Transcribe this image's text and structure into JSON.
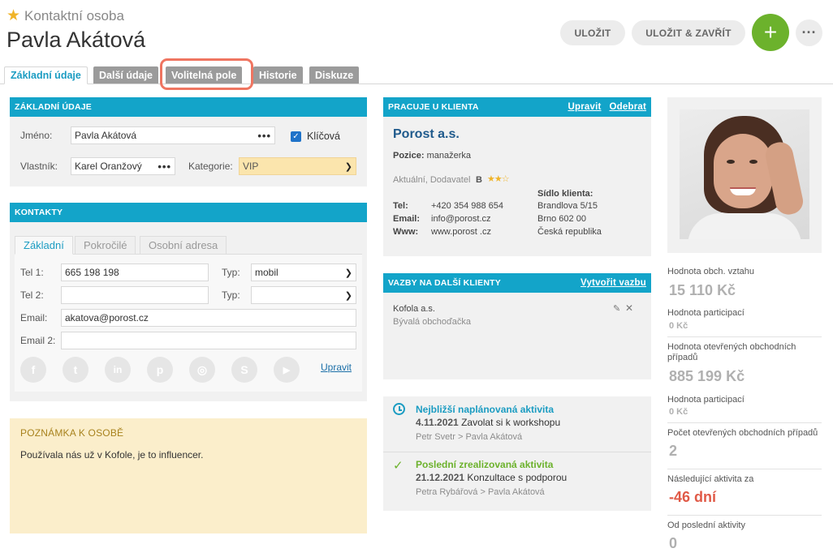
{
  "header": {
    "subtitle": "Kontaktní osoba",
    "title": "Pavla Akátová",
    "save_label": "ULOŽIT",
    "save_close_label": "ULOŽIT & ZAVŘÍT",
    "add_label": "+",
    "more_label": "···"
  },
  "tabs": [
    {
      "label": "Základní údaje"
    },
    {
      "label": "Další údaje"
    },
    {
      "label": "Volitelná pole"
    },
    {
      "label": "Historie"
    },
    {
      "label": "Diskuze"
    }
  ],
  "basic": {
    "heading": "ZÁKLADNÍ ÚDAJE",
    "name_label": "Jméno:",
    "name_value": "Pavla Akátová",
    "key_label": "Klíčová",
    "owner_label": "Vlastník:",
    "owner_value": "Karel Oranžový",
    "category_label": "Kategorie:",
    "category_value": "VIP",
    "dots": "•••"
  },
  "contacts": {
    "heading": "KONTAKTY",
    "subtabs": [
      "Základní",
      "Pokročilé",
      "Osobní adresa"
    ],
    "tel1_label": "Tel 1:",
    "tel1_value": "665 198 198",
    "type_label": "Typ:",
    "type1_value": "mobil",
    "tel2_label": "Tel 2:",
    "type2_label": "Typ:",
    "email_label": "Email:",
    "email_value": "akatova@porost.cz",
    "email2_label": "Email 2:",
    "edit_link": "Upravit",
    "social_icons": [
      "facebook-icon",
      "twitter-icon",
      "linkedin-icon",
      "pinterest-icon",
      "instagram-icon",
      "skype-icon",
      "youtube-icon"
    ]
  },
  "note": {
    "heading": "POZNÁMKA K OSOBĚ",
    "text": "Používala nás už v Kofole, je to influencer."
  },
  "client": {
    "heading": "PRACUJE U KLIENTA",
    "edit_link": "Upravit",
    "remove_link": "Odebrat",
    "name": "Porost a.s.",
    "position_label": "Pozice:",
    "position_value": "manažerka",
    "status": "Aktuální, Dodavatel",
    "rating_letter": "B",
    "tel_label": "Tel:",
    "tel_value": "+420 354 988 654",
    "email_label": "Email:",
    "email_value": "info@porost.cz",
    "www_label": "Www:",
    "www_value": "www.porost .cz",
    "seat_label": "Sídlo klienta:",
    "address1": "Brandlova 5/15",
    "address2": "Brno 602 00",
    "address3": "Česká republika"
  },
  "relations": {
    "heading": "VAZBY NA DALŠÍ KLIENTY",
    "create_link": "Vytvořit vazbu",
    "item_name": "Kofola a.s.",
    "item_role": "Bývalá obchoďačka"
  },
  "activities": {
    "next_title": "Nejbližší naplánovaná aktivita",
    "next_date": "4.11.2021",
    "next_desc": "Zavolat si k workshopu",
    "next_people": "Petr Svetr > Pavla Akátová",
    "last_title": "Poslední zrealizovaná aktivita",
    "last_date": "21.12.2021",
    "last_desc": "Konzultace s podporou",
    "last_people": "Petra Rybářová > Pavla Akátová"
  },
  "stats": {
    "value_label": "Hodnota obch. vztahu",
    "value": "15 110 Kč",
    "part1_label": "Hodnota participací",
    "part1": "0 Kč",
    "open_label": "Hodnota otevřených obchodních případů",
    "open_value": "885 199 Kč",
    "part2_label": "Hodnota participací",
    "part2": "0 Kč",
    "count_label": "Počet otevřených obchodních případů",
    "count": "2",
    "next_label": "Následující aktivita za",
    "next": "-46 dní",
    "last_label": "Od poslední aktivity",
    "last": "0"
  },
  "colors": {
    "accent": "#13a4c9",
    "primary_green": "#6cb22c",
    "danger": "#e05a47",
    "highlight": "#ef7561"
  }
}
